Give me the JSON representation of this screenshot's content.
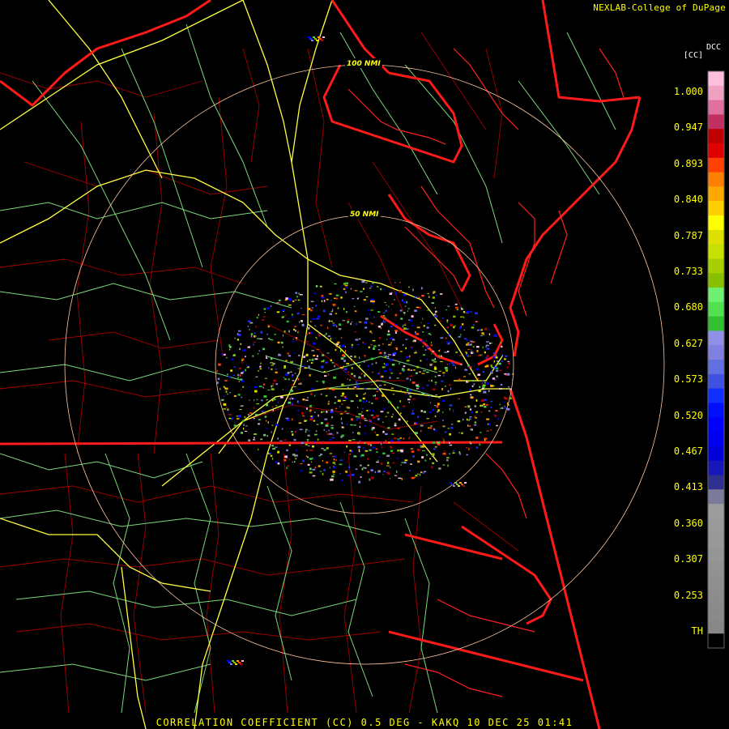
{
  "header": {
    "credit": "NEXLAB-College of DuPage"
  },
  "footer": {
    "caption": "CORRELATION COEFFICIENT (CC) 0.5 DEG - KAKQ 10 DEC 25 01:41"
  },
  "map": {
    "range_rings": [
      {
        "label": "100 NMI"
      },
      {
        "label": "50 NMI"
      }
    ]
  },
  "legend": {
    "product_code": "DCC",
    "unit": "[CC]",
    "ticks": [
      "1.000",
      "0.947",
      "0.893",
      "0.840",
      "0.787",
      "0.733",
      "0.680",
      "0.627",
      "0.573",
      "0.520",
      "0.467",
      "0.413",
      "0.360",
      "0.307",
      "0.253",
      "TH"
    ],
    "colors": [
      "#000000",
      "#888888",
      "#8a8a8a",
      "#8c8c8c",
      "#8f8f8f",
      "#929292",
      "#959595",
      "#989898",
      "#9a9a9a",
      "#9c9c9c",
      "#7a7a9a",
      "#303090",
      "#1818b8",
      "#0000d8",
      "#0000f0",
      "#0000ff",
      "#0010ff",
      "#1030ff",
      "#4050e0",
      "#6070e0",
      "#8080e0",
      "#9090e8",
      "#30c030",
      "#50e050",
      "#70f070",
      "#88c000",
      "#a8d000",
      "#c8e000",
      "#e0e000",
      "#ffff00",
      "#ffd000",
      "#ffa800",
      "#ff8000",
      "#ff4000",
      "#e00000",
      "#c00000",
      "#c03060",
      "#e070a0",
      "#f0a0c0",
      "#ffc0e0"
    ]
  },
  "colors": {
    "state_border": "#ff1a1a",
    "county_border": "#b00000",
    "highway_major": "#ffff40",
    "road_minor": "#80e080",
    "range_ring": "#ffc8a0",
    "text": "#ffff00"
  }
}
